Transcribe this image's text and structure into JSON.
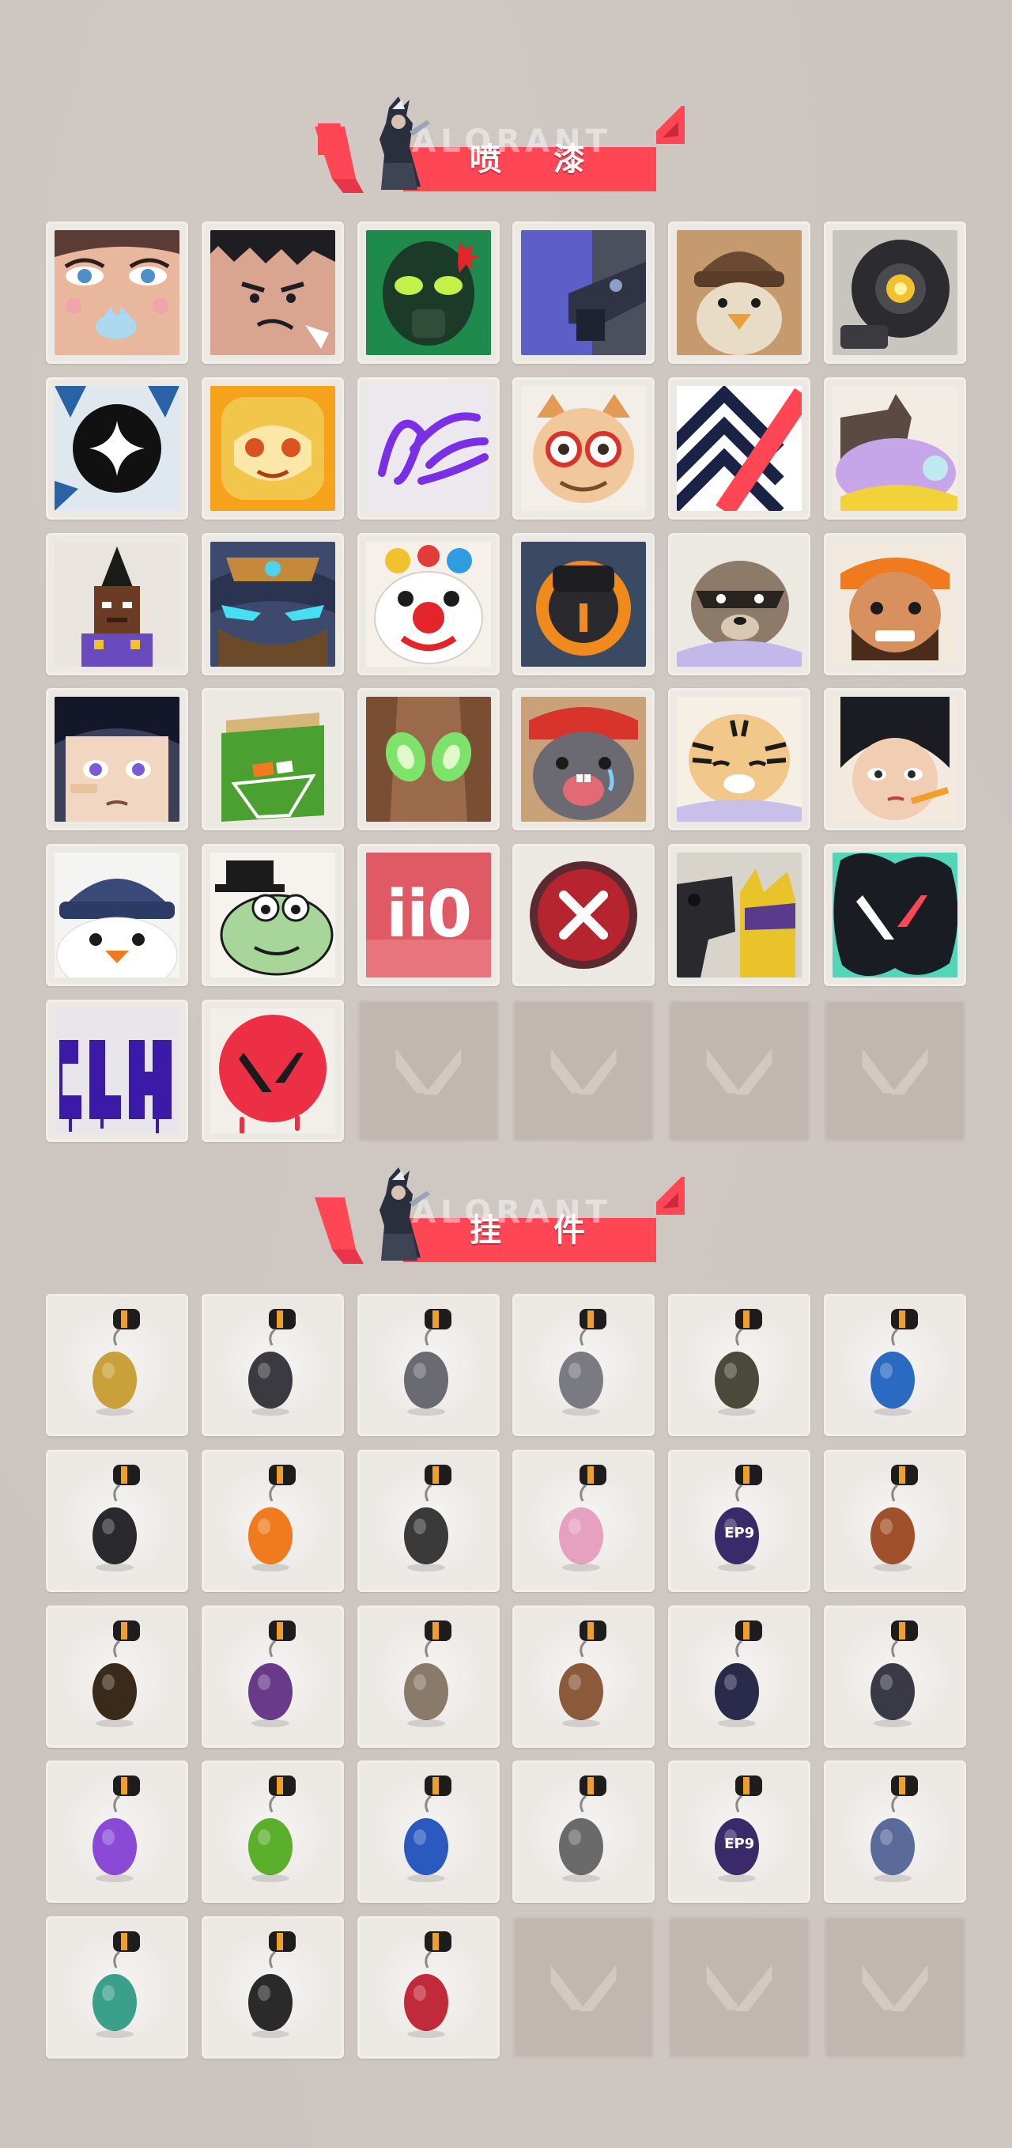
{
  "sections": {
    "sprays": {
      "title": "喷 漆",
      "watermark": "VALORANT",
      "items": [
        {
          "icon": "face-closeup-butterfly-spray-icon"
        },
        {
          "icon": "angry-boy-face-spray-icon"
        },
        {
          "icon": "green-gasmask-spray-icon"
        },
        {
          "icon": "purple-rifle-spray-icon"
        },
        {
          "icon": "beanie-penguin-spray-icon"
        },
        {
          "icon": "camera-robot-spray-icon"
        },
        {
          "icon": "black-star-badge-spray-icon"
        },
        {
          "icon": "orange-dragon-mask-spray-icon"
        },
        {
          "icon": "purple-signature-spray-icon"
        },
        {
          "icon": "goggles-cat-spray-icon"
        },
        {
          "icon": "chevron-stripes-spray-icon"
        },
        {
          "icon": "lavender-blob-spray-icon"
        },
        {
          "icon": "pixel-agent-spray-icon"
        },
        {
          "icon": "armored-helmet-spray-icon"
        },
        {
          "icon": "clown-face-spray-icon"
        },
        {
          "icon": "orange-dial-spray-icon"
        },
        {
          "icon": "raccoon-spray-icon"
        },
        {
          "icon": "bearded-man-spray-icon"
        },
        {
          "icon": "bandaged-boy-spray-icon"
        },
        {
          "icon": "green-crate-spray-icon"
        },
        {
          "icon": "green-eyes-spray-icon"
        },
        {
          "icon": "crying-mole-spray-icon"
        },
        {
          "icon": "tiger-spray-icon"
        },
        {
          "icon": "girl-with-pencil-spray-icon"
        },
        {
          "icon": "peeking-penguin-spray-icon"
        },
        {
          "icon": "frog-with-hat-spray-icon"
        },
        {
          "icon": "ii0-text-spray-icon",
          "text": "ii0"
        },
        {
          "icon": "red-x-button-spray-icon"
        },
        {
          "icon": "pistol-cat-spray-icon"
        },
        {
          "icon": "valorant-splatter-logo-spray-icon"
        },
        {
          "icon": "graffiti-tag-spray-icon"
        },
        {
          "icon": "red-v-drip-spray-icon"
        }
      ],
      "empty_slots": 4
    },
    "buddies": {
      "title": "挂 件",
      "watermark": "VALORANT",
      "items": [
        {
          "icon": "gold-cat-buddy-icon"
        },
        {
          "icon": "robot-drone-buddy-icon"
        },
        {
          "icon": "toast-tray-buddy-icon"
        },
        {
          "icon": "raccoon-figure-buddy-icon"
        },
        {
          "icon": "round-pouch-buddy-icon"
        },
        {
          "icon": "blue-bottle-buddy-icon"
        },
        {
          "icon": "chain-sword-buddy-icon"
        },
        {
          "icon": "orange-guitar-buddy-icon"
        },
        {
          "icon": "braided-cord-buddy-icon"
        },
        {
          "icon": "cupcake-buddy-icon"
        },
        {
          "icon": "ep9-medal-buddy-icon",
          "text": "EP9"
        },
        {
          "icon": "boxing-bear-buddy-icon"
        },
        {
          "icon": "turret-buddy-icon"
        },
        {
          "icon": "agent-figurine-buddy-icon"
        },
        {
          "icon": "cowboy-robot-buddy-icon"
        },
        {
          "icon": "cardboard-box-buddy-icon"
        },
        {
          "icon": "tasseled-creature-buddy-icon"
        },
        {
          "icon": "dark-claw-buddy-icon"
        },
        {
          "icon": "lava-lamp-buddy-icon"
        },
        {
          "icon": "green-pager-buddy-icon"
        },
        {
          "icon": "astronaut-buddy-icon"
        },
        {
          "icon": "radio-device-buddy-icon"
        },
        {
          "icon": "ep9-medal-dark-buddy-icon",
          "text": "EP9"
        },
        {
          "icon": "lantern-buddy-icon"
        },
        {
          "icon": "ufo-buddy-icon"
        },
        {
          "icon": "valorant-ring-buddy-icon"
        },
        {
          "icon": "red-gem-buddy-icon"
        }
      ],
      "empty_slots": 3
    }
  },
  "colors": {
    "background": "#ccc4bf",
    "accent_red": "#ff4655",
    "tile": "#ece9e5",
    "empty_tile": "#c1b7b0"
  }
}
